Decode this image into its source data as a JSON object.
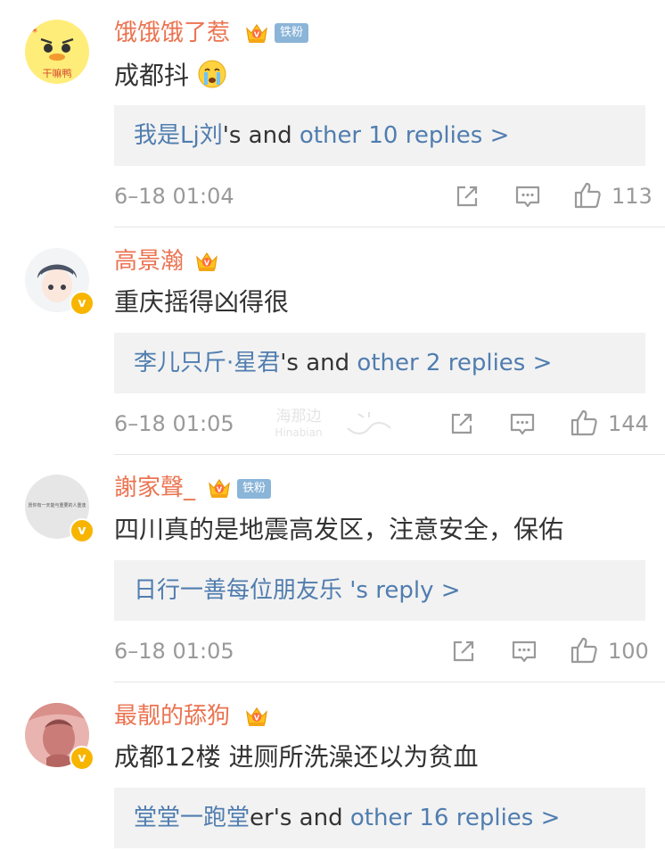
{
  "colors": {
    "name": "#eb7350",
    "link": "#507daf",
    "reply_bg": "#f2f2f2",
    "meta": "#999999",
    "fan_badge_bg": "#8ab4d8",
    "verified_badge": "#f7b500"
  },
  "watermark": {
    "line1": "海那边",
    "line2": "Hinabian"
  },
  "comments": [
    {
      "username": "饿饿饿了惹",
      "fan_badge": "铁粉",
      "avatar_text": "干嘛鸭",
      "content": "成都抖",
      "content_emoji": "crying-face-icon",
      "reply_user": "我是Lj刘",
      "reply_mid": "'s and ",
      "reply_link": "other 10 replies >",
      "time": "6–18 01:04",
      "likes": "113"
    },
    {
      "username": "高景瀚",
      "content": "重庆摇得凶得很",
      "verified": true,
      "reply_user": "李儿只斤·星君",
      "reply_mid": "'s and ",
      "reply_link": "other 2 replies >",
      "time": "6–18 01:05",
      "likes": "144"
    },
    {
      "username": "謝家聲_",
      "fan_badge": "铁粉",
      "avatar_text": "愿你有一天能与重要的人重逢",
      "content": "四川真的是地震高发区，注意安全，保佑",
      "verified": true,
      "reply_user": "日行一善每位朋友乐",
      "reply_mid": " ",
      "reply_link": "'s reply >",
      "time": "6–18 01:05",
      "likes": "100"
    },
    {
      "username": "最靓的舔狗",
      "content": "成都12楼 进厕所洗澡还以为贫血",
      "verified": true,
      "reply_user": "堂堂一跑堂",
      "reply_mid": "er's and ",
      "reply_link": "other 16 replies >",
      "time": "",
      "likes": ""
    }
  ]
}
